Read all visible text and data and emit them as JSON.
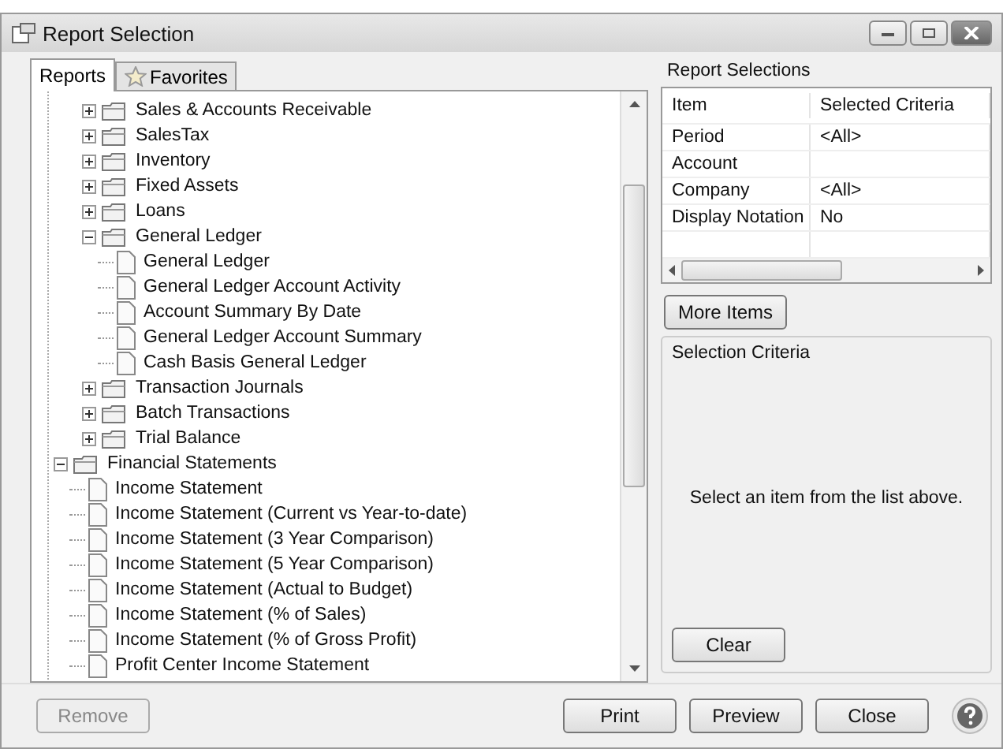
{
  "window": {
    "title": "Report Selection"
  },
  "tabs": [
    {
      "label": "Reports",
      "selected": true,
      "kind": "plain"
    },
    {
      "label": "Favorites",
      "selected": false,
      "kind": "star"
    }
  ],
  "tree": [
    {
      "kind": "continued",
      "children": [
        {
          "kind": "folder",
          "label": "Sales & Accounts Receivable",
          "expanded": false
        },
        {
          "kind": "folder",
          "label": "SalesTax",
          "expanded": false
        },
        {
          "kind": "folder",
          "label": "Inventory",
          "expanded": false
        },
        {
          "kind": "folder",
          "label": "Fixed Assets",
          "expanded": false
        },
        {
          "kind": "folder",
          "label": "Loans",
          "expanded": false
        },
        {
          "kind": "folder",
          "label": "General Ledger",
          "expanded": true,
          "children": [
            {
              "kind": "report",
              "label": "General Ledger"
            },
            {
              "kind": "report",
              "label": "General Ledger Account Activity"
            },
            {
              "kind": "report",
              "label": "Account Summary By Date"
            },
            {
              "kind": "report",
              "label": "General Ledger Account Summary"
            },
            {
              "kind": "report",
              "label": "Cash Basis General Ledger"
            }
          ]
        },
        {
          "kind": "folder",
          "label": "Transaction Journals",
          "expanded": false
        },
        {
          "kind": "folder",
          "label": "Batch Transactions",
          "expanded": false
        },
        {
          "kind": "folder",
          "label": "Trial Balance",
          "expanded": false
        }
      ]
    },
    {
      "kind": "folder",
      "label": "Financial Statements",
      "expanded": true,
      "children": [
        {
          "kind": "report",
          "label": "Income Statement"
        },
        {
          "kind": "report",
          "label": "Income Statement (Current vs Year-to-date)"
        },
        {
          "kind": "report",
          "label": "Income Statement (3 Year Comparison)"
        },
        {
          "kind": "report",
          "label": "Income Statement (5 Year Comparison)"
        },
        {
          "kind": "report",
          "label": "Income Statement (Actual to Budget)"
        },
        {
          "kind": "report",
          "label": "Income Statement (% of Sales)"
        },
        {
          "kind": "report",
          "label": "Income Statement (% of Gross Profit)"
        },
        {
          "kind": "report",
          "label": "Profit Center Income Statement"
        }
      ]
    }
  ],
  "report_selections": {
    "title": "Report Selections",
    "columns": [
      "Item",
      "Selected Criteria"
    ],
    "rows": [
      [
        "Period",
        "<All>"
      ],
      [
        "Account",
        null
      ],
      [
        "Company",
        "<All>"
      ],
      [
        "Display Notation",
        "No"
      ]
    ],
    "more_button": "More Items"
  },
  "selection_criteria": {
    "title": "Selection Criteria",
    "message": "Select an item from the list above.",
    "clear_button": "Clear"
  },
  "buttons": {
    "remove": {
      "label": "Remove",
      "disabled": true
    },
    "print": "Print",
    "preview": "Preview",
    "close": "Close"
  }
}
